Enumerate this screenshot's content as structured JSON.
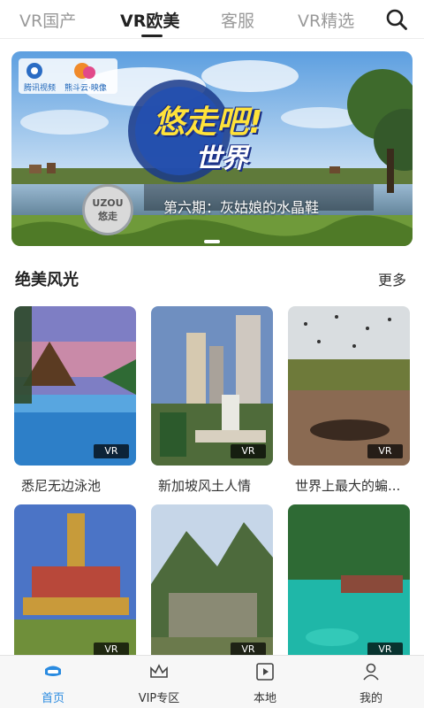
{
  "top_tabs": [
    {
      "label": "VR国产",
      "active": false
    },
    {
      "label": "VR欧美",
      "active": true
    },
    {
      "label": "客服",
      "active": false
    },
    {
      "label": "VR精选",
      "active": false
    }
  ],
  "search": {
    "icon": "search-icon"
  },
  "banner": {
    "logo_left": "腾讯视频",
    "logo_right": "熊斗云·映像",
    "title_line1": "悠走吧!",
    "title_line2": "世界",
    "badge_line1": "UZOU",
    "badge_line2": "悠走",
    "caption": "第六期：灰姑娘的水晶鞋",
    "slide_index": 1
  },
  "section": {
    "title": "绝美风光",
    "more_label": "更多"
  },
  "cards": [
    {
      "title": "悉尼无边泳池",
      "tag": "VR"
    },
    {
      "title": "新加坡风土人情",
      "tag": "VR"
    },
    {
      "title": "世界上最大的蝙...",
      "tag": "VR"
    },
    {
      "title": "",
      "tag": "VR"
    },
    {
      "title": "",
      "tag": "VR"
    },
    {
      "title": "",
      "tag": "VR"
    }
  ],
  "bottom_nav": [
    {
      "label": "首页",
      "icon": "home-vr-icon",
      "active": true
    },
    {
      "label": "VIP专区",
      "icon": "crown-icon",
      "active": false
    },
    {
      "label": "本地",
      "icon": "local-video-icon",
      "active": false
    },
    {
      "label": "我的",
      "icon": "profile-icon",
      "active": false
    }
  ],
  "colors": {
    "accent": "#2a8be0",
    "active_tab": "#222222",
    "inactive_tab": "#9a9a9a"
  }
}
